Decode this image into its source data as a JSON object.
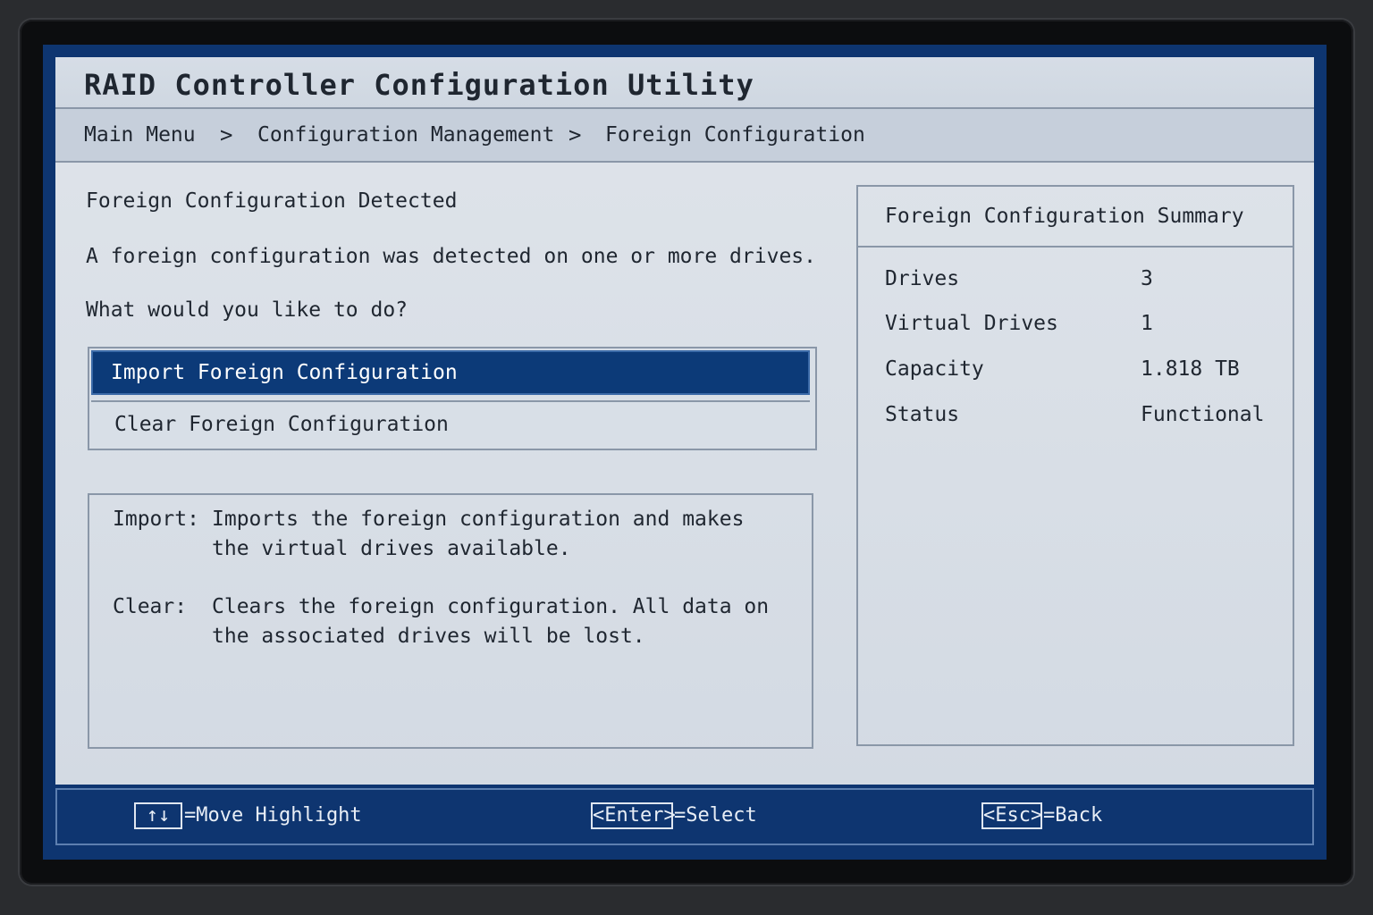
{
  "title": "RAID Controller Configuration Utility",
  "breadcrumb": {
    "items": [
      "Main Menu",
      "Configuration Management",
      "Foreign Configuration"
    ],
    "separator": ">"
  },
  "main": {
    "heading": "Foreign Configuration Detected",
    "message": "A foreign configuration was detected on one or more drives.",
    "question": "What would you like to do?",
    "options": [
      {
        "label": "Import Foreign Configuration",
        "selected": true
      },
      {
        "label": "Clear Foreign Configuration",
        "selected": false
      }
    ],
    "help": {
      "import_key": "Import:",
      "import_line1": "Imports the foreign configuration and makes",
      "import_line2": "the virtual drives available.",
      "clear_key": "Clear:",
      "clear_line1": "Clears the foreign configuration. All data on",
      "clear_line2": "the associated drives will be lost."
    }
  },
  "summary": {
    "title": "Foreign Configuration Summary",
    "rows": [
      {
        "label": "Drives",
        "value": "3"
      },
      {
        "label": "Virtual Drives",
        "value": "1"
      },
      {
        "label": "Capacity",
        "value": "1.818 TB"
      },
      {
        "label": "Status",
        "value": "Functional"
      }
    ]
  },
  "footer": {
    "move_key": "↑↓",
    "move_label": "=Move Highlight",
    "enter_key": "<Enter>",
    "enter_label": "=Select",
    "esc_key": "<Esc>",
    "esc_label": "=Back"
  },
  "colors": {
    "accent": "#0c3a78",
    "panel": "#d8dfe7",
    "footer": "#0e3570"
  }
}
